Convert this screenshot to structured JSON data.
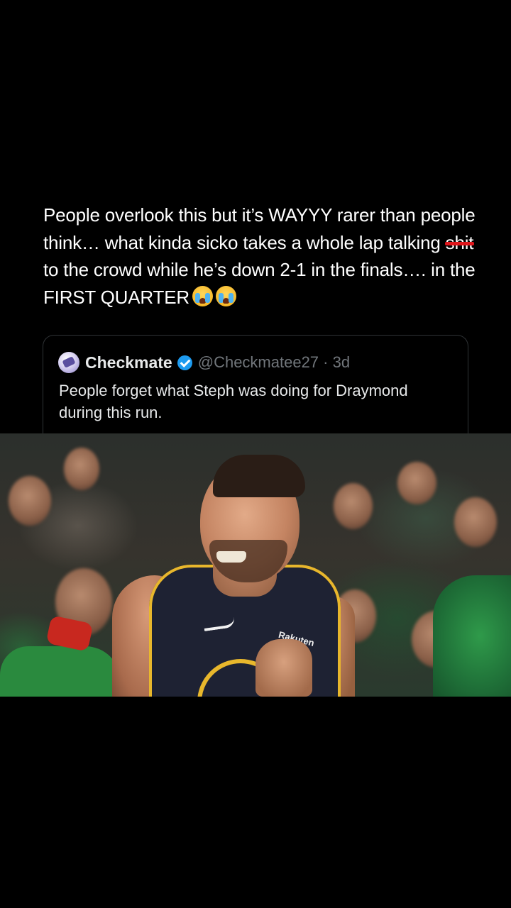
{
  "post": {
    "text_part1": "People overlook this but it’s WAYYY rarer than people think… what kinda sicko takes a whole lap talking ",
    "censored_word": "shit",
    "text_part2": " to the crowd while he’s down 2-1 in the finals…. in the FIRST QUARTER",
    "emojis": [
      "loudly-crying-face-icon",
      "loudly-crying-face-icon"
    ]
  },
  "quoted_post": {
    "display_name": "Checkmate",
    "verified": true,
    "handle_meta": "@Checkmatee27 · 3d",
    "text": "People forget what Steph was doing for Draymond during this run."
  },
  "video": {
    "jersey_sponsor": "Rakuten"
  },
  "colors": {
    "background": "#000000",
    "text": "#ffffff",
    "secondary_text": "#71767b",
    "verified_badge": "#1d9bf0",
    "censor_bar": "#e0161b",
    "card_border": "#2f3336"
  }
}
